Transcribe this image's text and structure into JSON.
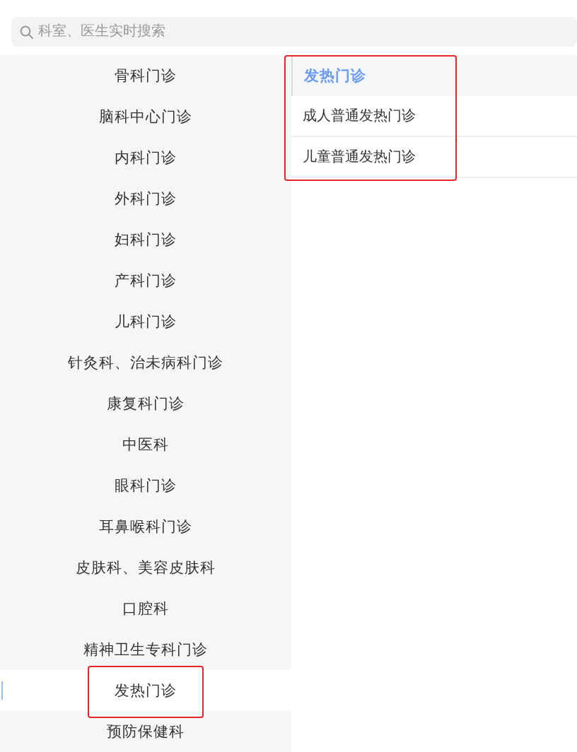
{
  "search": {
    "placeholder": "科室、医生实时搜索"
  },
  "departments": [
    {
      "label": "骨科门诊",
      "selected": false
    },
    {
      "label": "脑科中心门诊",
      "selected": false
    },
    {
      "label": "内科门诊",
      "selected": false
    },
    {
      "label": "外科门诊",
      "selected": false
    },
    {
      "label": "妇科门诊",
      "selected": false
    },
    {
      "label": "产科门诊",
      "selected": false
    },
    {
      "label": "儿科门诊",
      "selected": false
    },
    {
      "label": "针灸科、治未病科门诊",
      "selected": false
    },
    {
      "label": "康复科门诊",
      "selected": false
    },
    {
      "label": "中医科",
      "selected": false
    },
    {
      "label": "眼科门诊",
      "selected": false
    },
    {
      "label": "耳鼻喉科门诊",
      "selected": false
    },
    {
      "label": "皮肤科、美容皮肤科",
      "selected": false
    },
    {
      "label": "口腔科",
      "selected": false
    },
    {
      "label": "精神卫生专科门诊",
      "selected": false
    },
    {
      "label": "发热门诊",
      "selected": true
    },
    {
      "label": "预防保健科",
      "selected": false
    }
  ],
  "sub_panel": {
    "header": "发热门诊",
    "items": [
      "成人普通发热门诊",
      "儿童普通发热门诊"
    ]
  }
}
